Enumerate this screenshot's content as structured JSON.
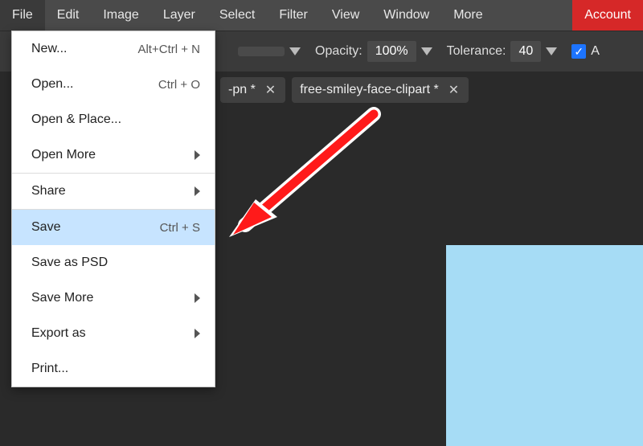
{
  "menubar": {
    "items": [
      "File",
      "Edit",
      "Image",
      "Layer",
      "Select",
      "Filter",
      "View",
      "Window",
      "More"
    ],
    "account": "Account"
  },
  "options": {
    "opacity_label": "Opacity:",
    "opacity_value": "100%",
    "tolerance_label": "Tolerance:",
    "tolerance_value": "40",
    "checkbox_label": "A"
  },
  "tabs": [
    {
      "label": "-pn *"
    },
    {
      "label": "free-smiley-face-clipart *"
    }
  ],
  "file_menu": [
    {
      "label": "New...",
      "shortcut": "Alt+Ctrl + N"
    },
    {
      "label": "Open...",
      "shortcut": "Ctrl + O"
    },
    {
      "label": "Open & Place..."
    },
    {
      "label": "Open More",
      "submenu": true
    },
    {
      "sep": true
    },
    {
      "label": "Share",
      "submenu": true
    },
    {
      "sep": true
    },
    {
      "label": "Save",
      "shortcut": "Ctrl + S",
      "highlight": true
    },
    {
      "label": "Save as PSD"
    },
    {
      "label": "Save More",
      "submenu": true
    },
    {
      "label": "Export as",
      "submenu": true
    },
    {
      "label": "Print..."
    }
  ],
  "colors": {
    "accent": "#d62828",
    "canvas": "#a6dcf5"
  }
}
